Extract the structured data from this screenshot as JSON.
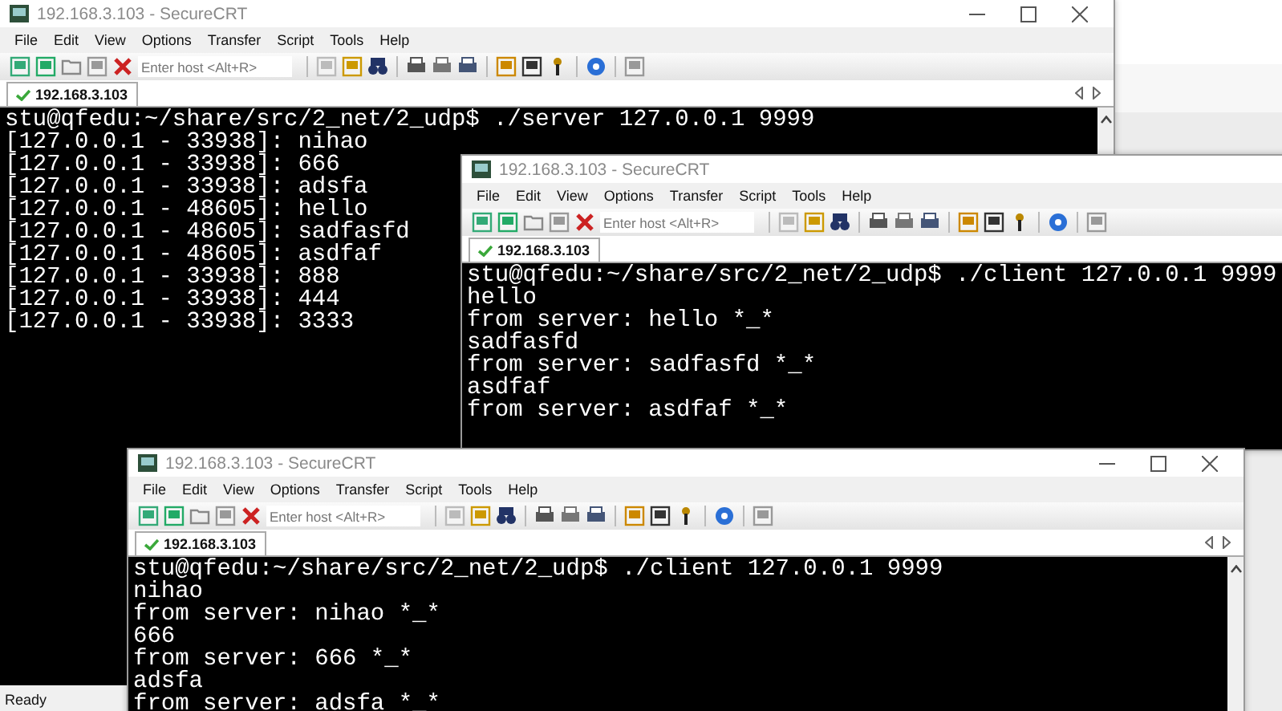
{
  "windows": [
    {
      "title": "192.168.3.103 - SecureCRT",
      "menu": [
        "File",
        "Edit",
        "View",
        "Options",
        "Transfer",
        "Script",
        "Tools",
        "Help"
      ],
      "host_placeholder": "Enter host <Alt+R>",
      "tab": {
        "label": "192.168.3.103",
        "connected": true
      },
      "lines": [
        "stu@qfedu:~/share/src/2_net/2_udp$ ./server 127.0.0.1 9999",
        "[127.0.0.1 - 33938]: nihao",
        "[127.0.0.1 - 33938]: 666",
        "[127.0.0.1 - 33938]: adsfa",
        "[127.0.0.1 - 48605]: hello",
        "[127.0.0.1 - 48605]: sadfasfd",
        "[127.0.0.1 - 48605]: asdfaf",
        "[127.0.0.1 - 33938]: 888",
        "[127.0.0.1 - 33938]: 444",
        "[127.0.0.1 - 33938]: 3333"
      ],
      "status": "Ready"
    },
    {
      "title": "192.168.3.103 - SecureCRT",
      "menu": [
        "File",
        "Edit",
        "View",
        "Options",
        "Transfer",
        "Script",
        "Tools",
        "Help"
      ],
      "host_placeholder": "Enter host <Alt+R>",
      "tab": {
        "label": "192.168.3.103",
        "connected": true
      },
      "lines": [
        "stu@qfedu:~/share/src/2_net/2_udp$ ./client 127.0.0.1 9999",
        "hello",
        "from server: hello *_*",
        "sadfasfd",
        "from server: sadfasfd *_*",
        "asdfaf",
        "from server: asdfaf *_*"
      ]
    },
    {
      "title": "192.168.3.103 - SecureCRT",
      "menu": [
        "File",
        "Edit",
        "View",
        "Options",
        "Transfer",
        "Script",
        "Tools",
        "Help"
      ],
      "host_placeholder": "Enter host <Alt+R>",
      "tab": {
        "label": "192.168.3.103",
        "connected": true
      },
      "lines": [
        "stu@qfedu:~/share/src/2_net/2_udp$ ./client 127.0.0.1 9999",
        "nihao",
        "from server: nihao *_*",
        "666",
        "from server: 666 *_*",
        "adsfa",
        "from server: adsfa *_*"
      ]
    }
  ]
}
